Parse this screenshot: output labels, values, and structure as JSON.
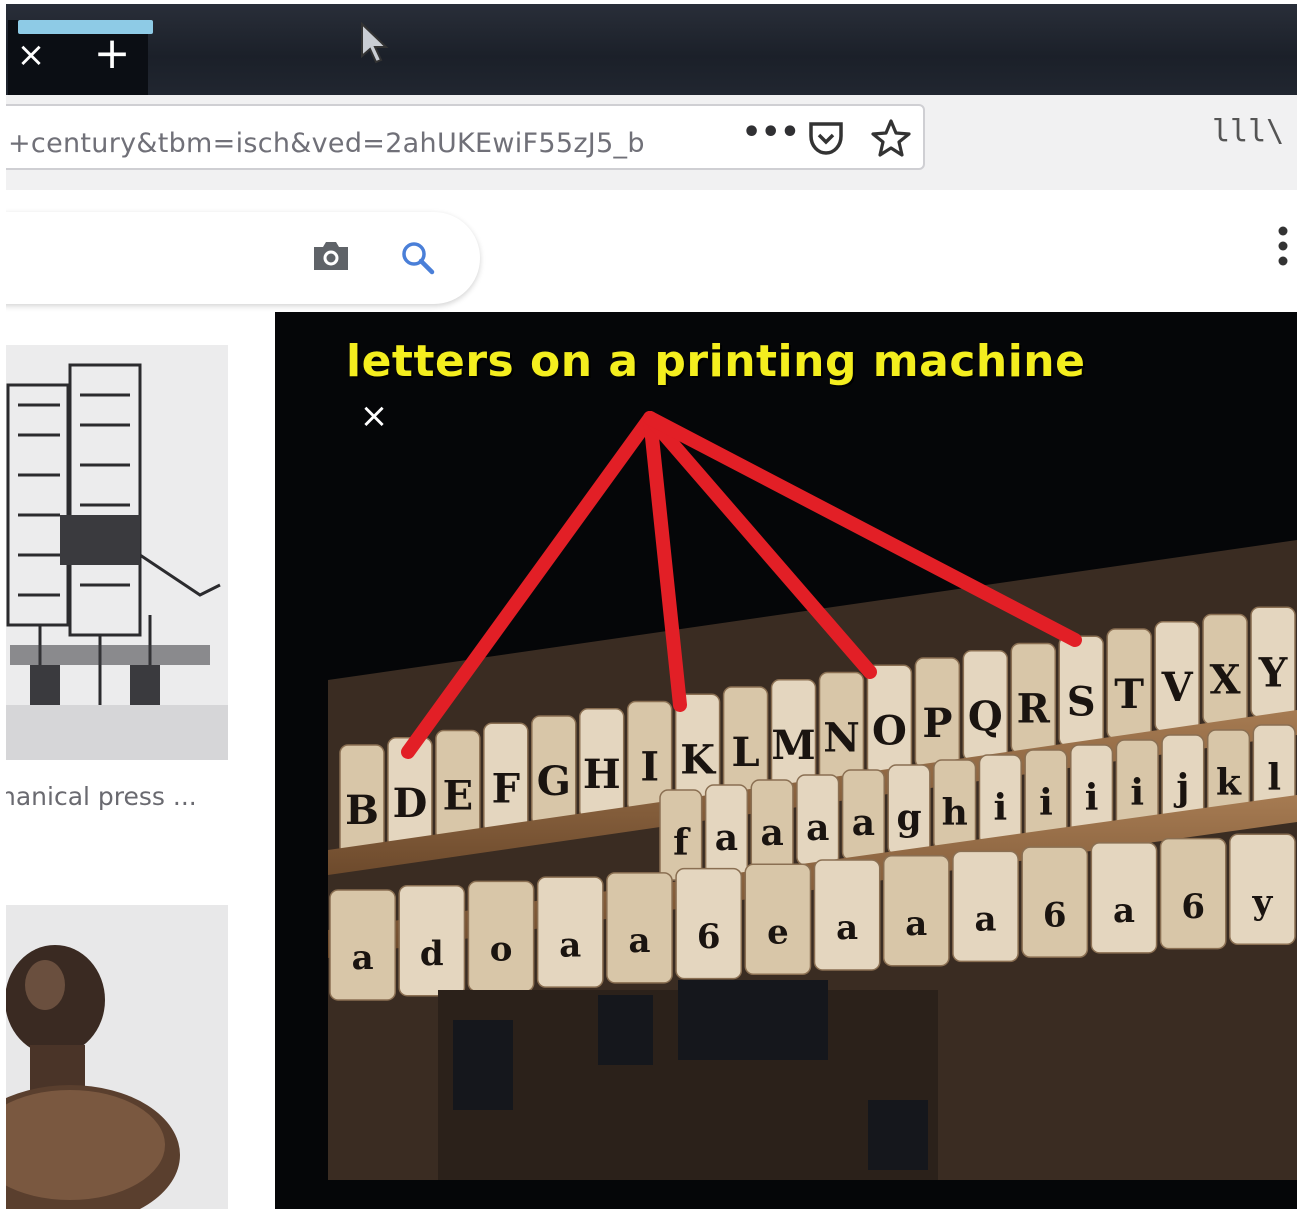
{
  "browser": {
    "tab_close_symbol": "×",
    "new_tab_symbol": "+",
    "url": "+century&tbm=isch&ved=2ahUKEwiF55zJ5_b",
    "page_actions_symbol": "•••",
    "library_symbol": "lll\\"
  },
  "results": {
    "thumb1_caption": "hanical press ..."
  },
  "viewer": {
    "close_symbol": "×",
    "annotation": "letters on a printing machine",
    "annotation_color": "#f4ee1e",
    "arrow_color": "#e21f26"
  },
  "type_case": {
    "row1": [
      "B",
      "D",
      "E",
      "F",
      "G",
      "H",
      "I",
      "K",
      "L",
      "M",
      "N",
      "O",
      "P",
      "Q",
      "R",
      "S",
      "T",
      "V",
      "X",
      "Y"
    ],
    "row2": [
      "f",
      "a",
      "a",
      "a",
      "a",
      "g",
      "h",
      "i",
      "i",
      "i",
      "i",
      "j",
      "k",
      "l"
    ],
    "row3": [
      "a",
      "d",
      "o",
      "a",
      "a",
      "6",
      "e",
      "a",
      "a",
      "a",
      "6",
      "a",
      "6",
      "y"
    ]
  }
}
